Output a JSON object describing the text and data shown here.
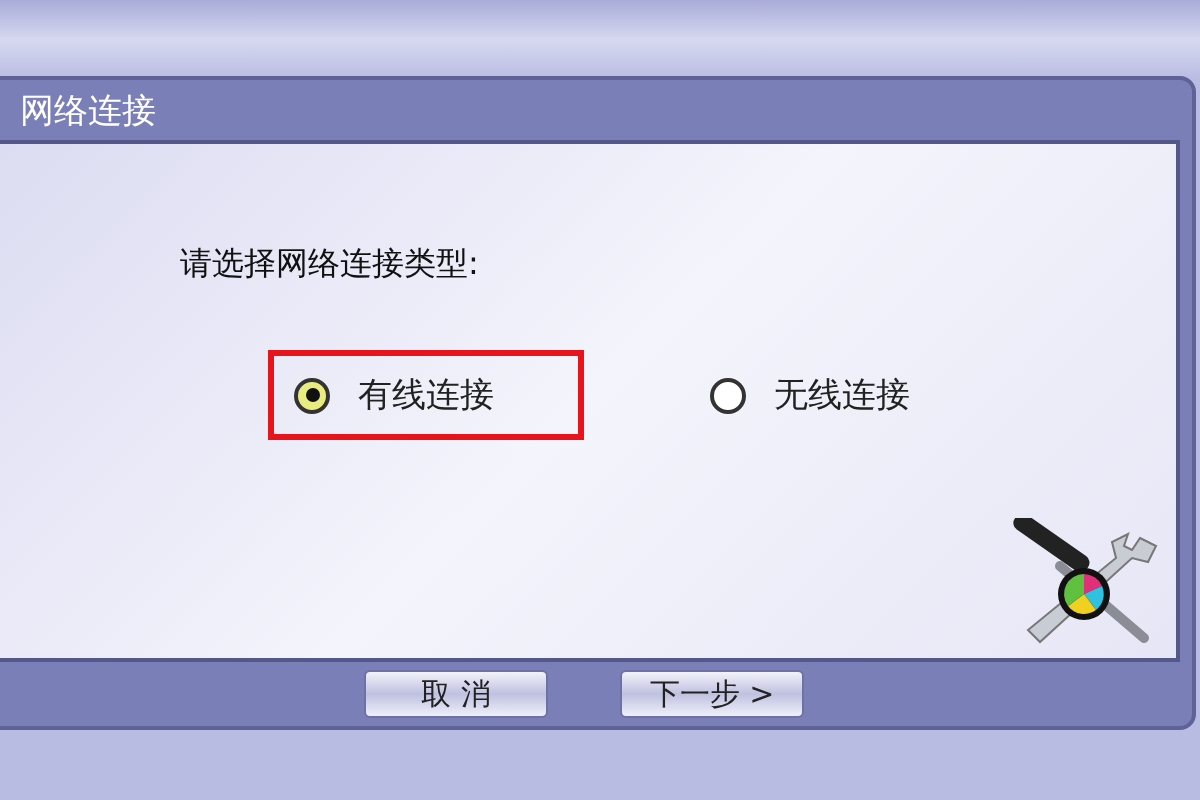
{
  "dialog": {
    "title": "网络连接",
    "prompt": "请选择网络连接类型:",
    "options": [
      {
        "label": "有线连接",
        "selected": true,
        "focused": true
      },
      {
        "label": "无线连接",
        "selected": false,
        "focused": false
      }
    ],
    "buttons": [
      {
        "label": "取 消"
      },
      {
        "label": "下一步 >"
      }
    ]
  }
}
